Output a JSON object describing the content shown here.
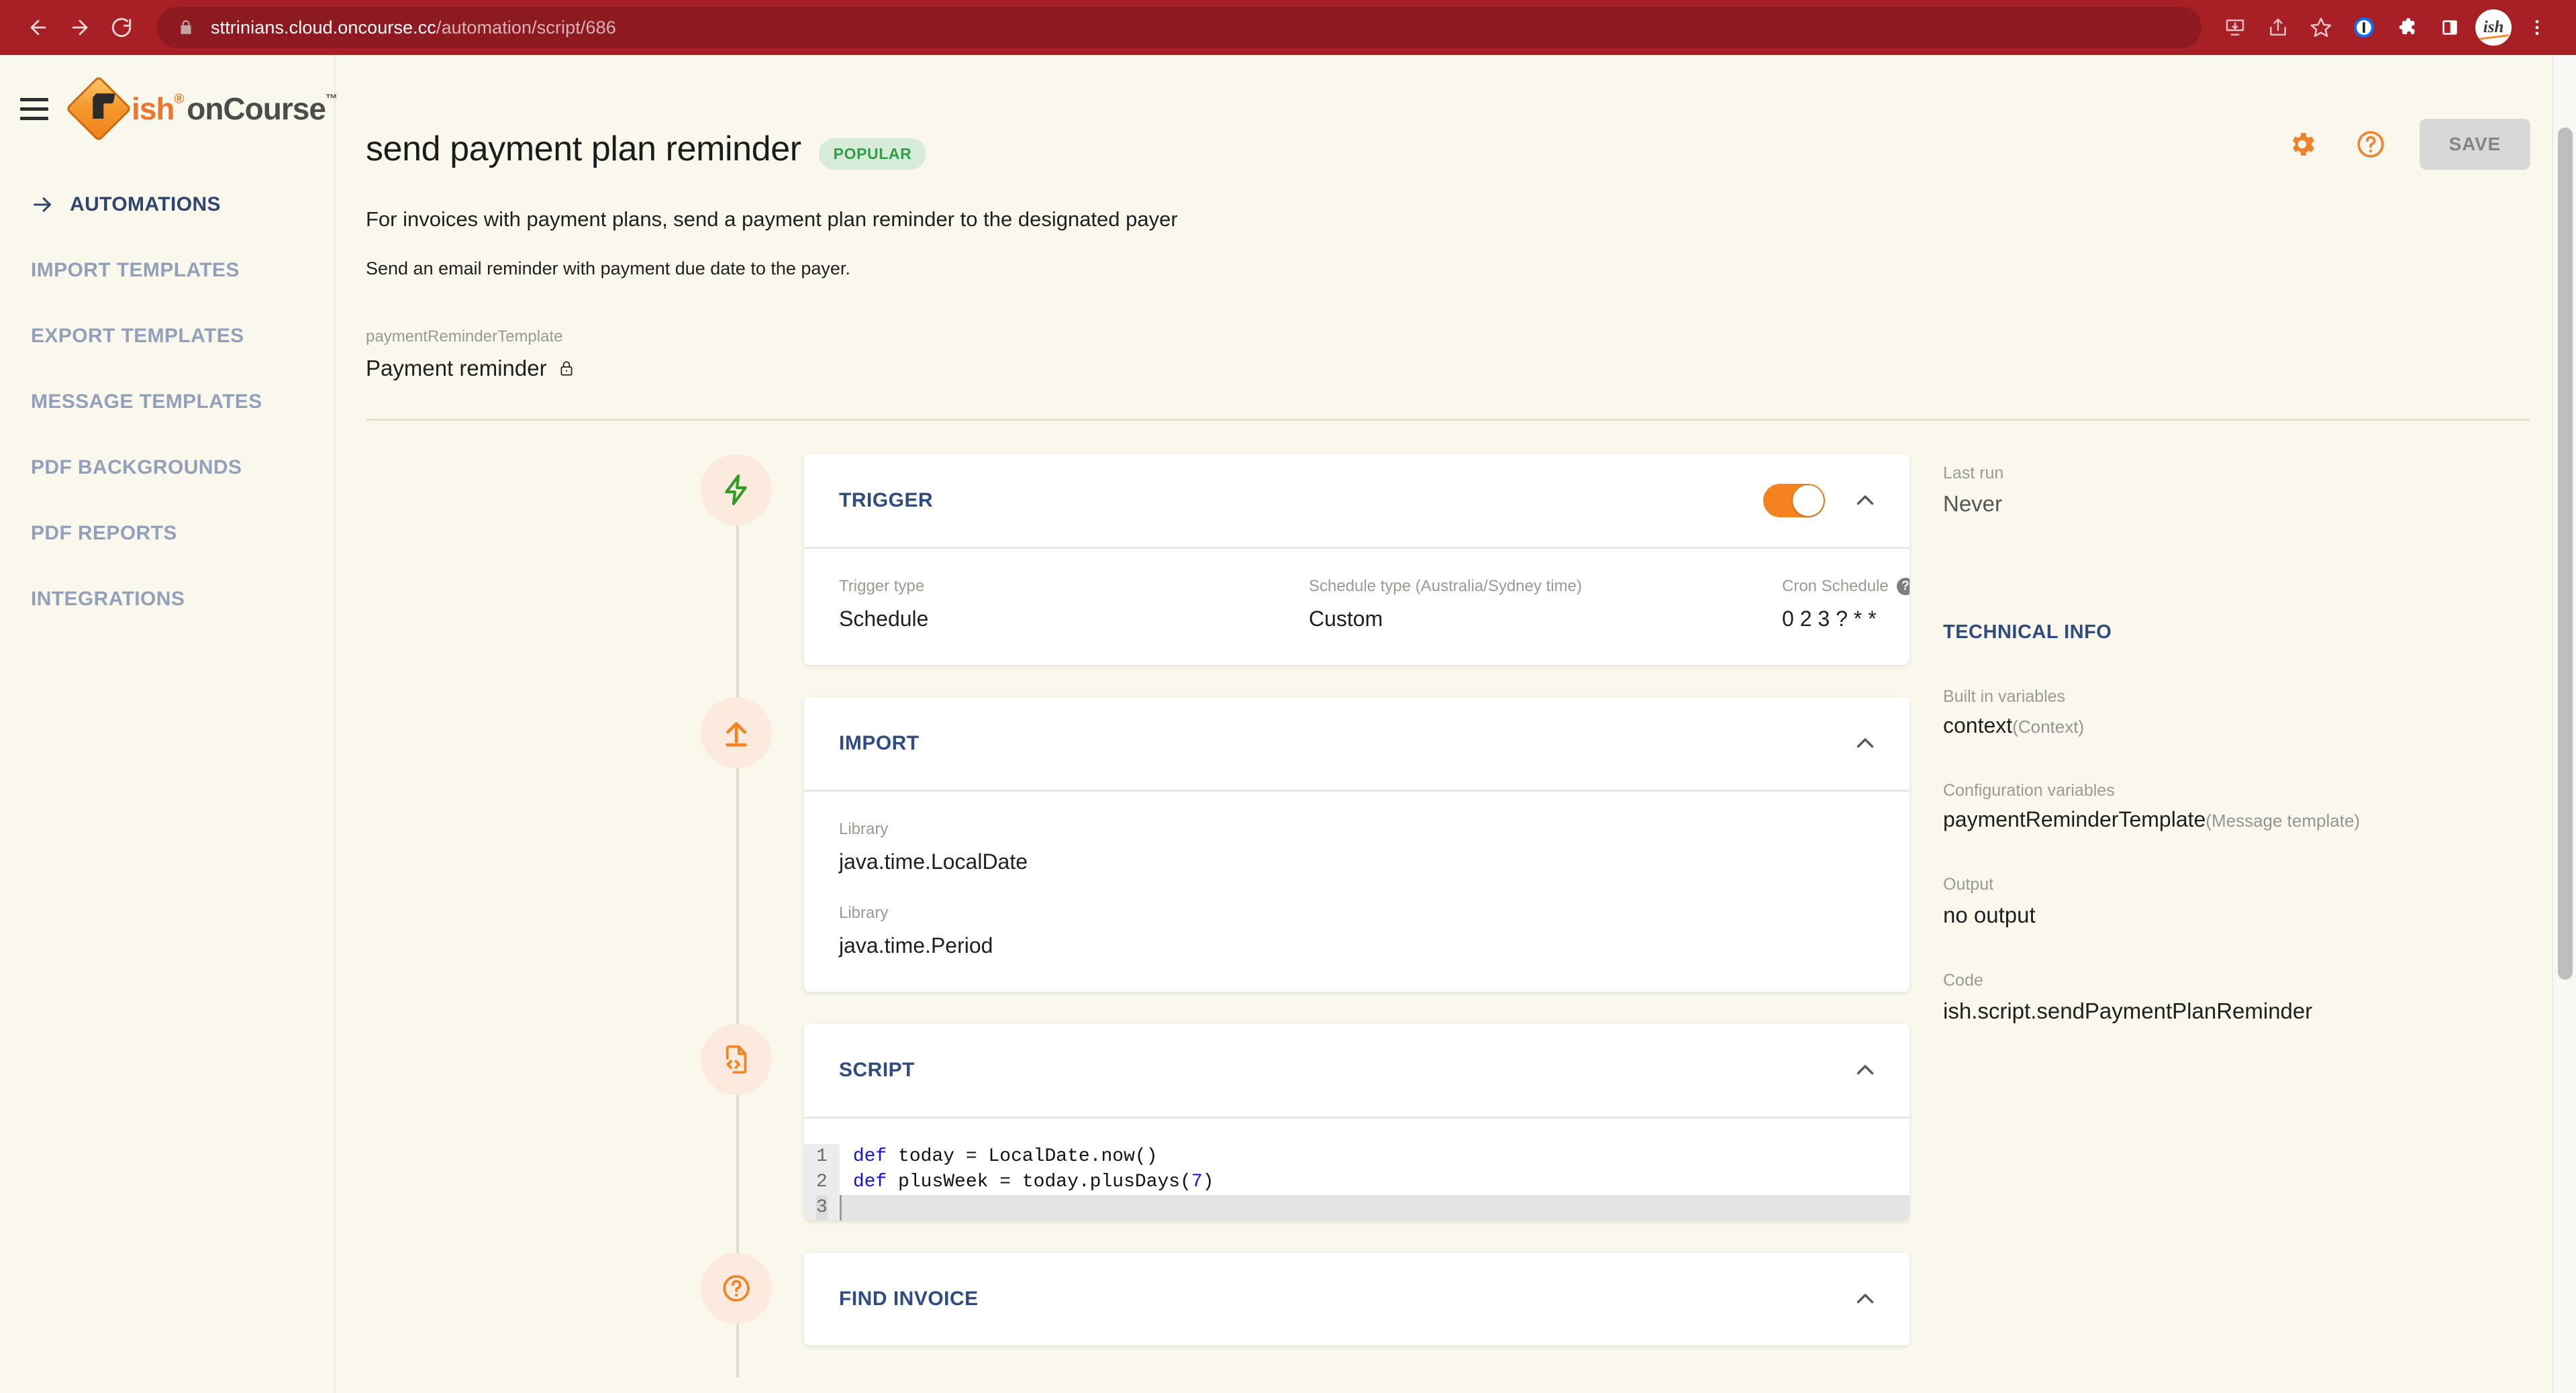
{
  "browser": {
    "back_icon": "arrow-left-icon",
    "forward_icon": "arrow-right-icon",
    "reload_icon": "reload-icon",
    "lock_icon": "lock-icon",
    "url_domain": "sttrinians.cloud.oncourse.cc",
    "url_path": "/automation/script/686",
    "actions": [
      {
        "name": "install-app-icon",
        "label": "install"
      },
      {
        "name": "share-icon",
        "label": "share"
      },
      {
        "name": "bookmark-star-icon",
        "label": "bookmark"
      },
      {
        "name": "onepassword-icon",
        "label": "1Password"
      },
      {
        "name": "extensions-puzzle-icon",
        "label": "extensions"
      },
      {
        "name": "side-panel-icon",
        "label": "side panel"
      },
      {
        "name": "profile-avatar",
        "label": "ish"
      },
      {
        "name": "chrome-menu-icon",
        "label": "menu"
      }
    ],
    "theme_color": "#a91f26"
  },
  "sidebar": {
    "menu_icon": "hamburger-menu-icon",
    "logo": {
      "ish": "ish",
      "registered": "®",
      "oncourse": "onCourse",
      "tm": "™"
    },
    "items": [
      {
        "label": "AUTOMATIONS",
        "active": true
      },
      {
        "label": "IMPORT TEMPLATES",
        "active": false
      },
      {
        "label": "EXPORT TEMPLATES",
        "active": false
      },
      {
        "label": "MESSAGE TEMPLATES",
        "active": false
      },
      {
        "label": "PDF BACKGROUNDS",
        "active": false
      },
      {
        "label": "PDF REPORTS",
        "active": false
      },
      {
        "label": "INTEGRATIONS",
        "active": false
      }
    ]
  },
  "header": {
    "title": "send payment plan reminder",
    "badge": "POPULAR",
    "badge_color": "#2f9e44",
    "settings_icon": "gear-icon",
    "help_icon": "help-circle-icon",
    "save_label": "SAVE",
    "accent_color": "#f0812e"
  },
  "description": {
    "main": "For invoices with payment plans, send a payment plan reminder to the designated payer",
    "sub": "Send an email reminder with payment due date to the payer."
  },
  "template_field": {
    "label": "paymentReminderTemplate",
    "value": "Payment reminder",
    "lock_icon": "lock-closed-icon"
  },
  "blocks": [
    {
      "id": "trigger",
      "icon": "lightning-bolt-icon",
      "icon_color": "#2f9e23",
      "title": "TRIGGER",
      "toggle_on": true,
      "collapse_icon": "chevron-up-icon",
      "fields": [
        {
          "label": "Trigger type",
          "value": "Schedule",
          "help": false
        },
        {
          "label": "Schedule type (Australia/Sydney time)",
          "value": "Custom",
          "help": false
        },
        {
          "label": "Cron Schedule",
          "value": "0 2 3 ? * *",
          "help": true
        }
      ]
    },
    {
      "id": "import",
      "icon": "upload-arrow-icon",
      "icon_color": "#f3821f",
      "title": "IMPORT",
      "toggle_on": null,
      "collapse_icon": "chevron-up-icon",
      "libraries": [
        {
          "label": "Library",
          "value": "java.time.LocalDate"
        },
        {
          "label": "Library",
          "value": "java.time.Period"
        }
      ]
    },
    {
      "id": "script",
      "icon": "code-file-icon",
      "icon_color": "#f3821f",
      "title": "SCRIPT",
      "collapse_icon": "chevron-up-icon",
      "code_lines": [
        {
          "n": "1",
          "kw": "def",
          "rest": " today = LocalDate.now()",
          "current": false
        },
        {
          "n": "2",
          "kw": "def",
          "rest": " plusWeek = today.plusDays(7)",
          "current": false
        },
        {
          "n": "3",
          "kw": "",
          "rest": "",
          "current": true
        }
      ]
    },
    {
      "id": "find-invoice",
      "icon": "question-circle-icon",
      "icon_color": "#f3821f",
      "title": "FIND INVOICE",
      "collapse_icon": "chevron-up-icon"
    }
  ],
  "technical": {
    "last_run_label": "Last run",
    "last_run_value": "Never",
    "section_title": "TECHNICAL INFO",
    "collapse_icon": "chevron-up-icon",
    "builtin_label": "Built in variables",
    "builtin_name": "context",
    "builtin_type": "(Context)",
    "config_label": "Configuration variables",
    "config_name": "paymentReminderTemplate",
    "config_type": "(Message template)",
    "output_label": "Output",
    "output_value": "no output",
    "code_label": "Code",
    "code_value": "ish.script.sendPaymentPlanReminder"
  }
}
